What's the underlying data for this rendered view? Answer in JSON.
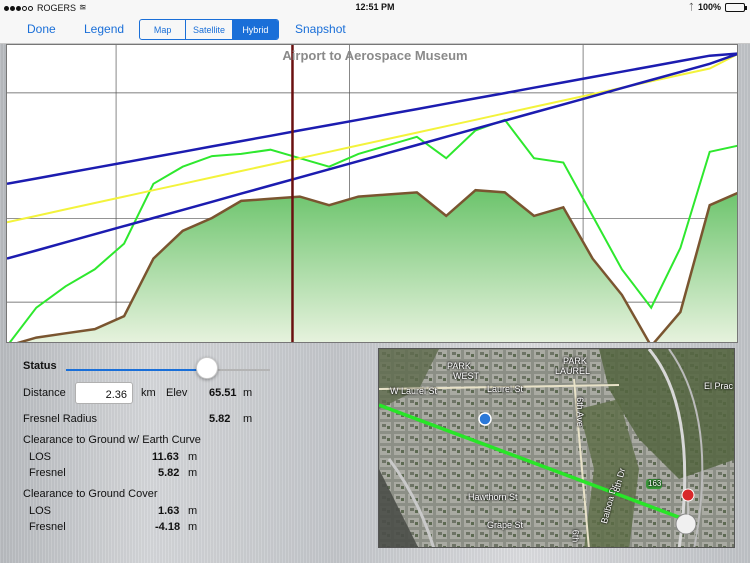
{
  "status_bar": {
    "carrier": "ROGERS",
    "time": "12:51 PM",
    "battery": "100%"
  },
  "toolbar": {
    "done_label": "Done",
    "legend_label": "Legend",
    "map_types": [
      "Map",
      "Satellite",
      "Hybrid"
    ],
    "selected_map_type": "Hybrid",
    "snapshot_label": "Snapshot"
  },
  "colors": {
    "accent": "#1a6fd8",
    "los_line": "#1c1cb0",
    "fresnel_center": "#f3f33c",
    "ground_cover": "#2ee82e",
    "terrain_fill": "#6cc46c",
    "terrain_edge": "#7a5530",
    "cursor": "#6a1010"
  },
  "chart_data": {
    "type": "line",
    "title": "Airport to Aerospace Museum",
    "grid": true,
    "x": [
      0,
      0.04,
      0.08,
      0.12,
      0.16,
      0.2,
      0.24,
      0.28,
      0.32,
      0.36,
      0.4,
      0.44,
      0.48,
      0.52,
      0.56,
      0.6,
      0.64,
      0.68,
      0.72,
      0.76,
      0.8,
      0.84,
      0.88,
      0.92,
      0.96,
      1.0
    ],
    "series": [
      {
        "key": "terrain",
        "values": [
          -6,
          -2,
          0,
          2,
          8,
          35,
          48,
          54,
          62,
          63,
          64,
          60,
          64,
          65,
          66,
          55,
          67,
          66,
          55,
          59,
          35,
          18,
          -6,
          10,
          60,
          66
        ]
      },
      {
        "key": "ground_cover",
        "values": [
          -6,
          12,
          22,
          30,
          42,
          70,
          78,
          83,
          84,
          86,
          82,
          78,
          84,
          88,
          92,
          82,
          95,
          100,
          82,
          80,
          55,
          30,
          12,
          40,
          85,
          88
        ]
      },
      {
        "key": "los_upper",
        "values": [
          70,
          72.5,
          75,
          77.5,
          80,
          82.5,
          85,
          87.5,
          90,
          92.5,
          95,
          97.5,
          100,
          102.5,
          105,
          107.5,
          110,
          112.5,
          115,
          117.5,
          120,
          122.5,
          125,
          127.5,
          130,
          131
        ]
      },
      {
        "key": "fresnel_center",
        "values": [
          52,
          55,
          58,
          61,
          64,
          67,
          70,
          73,
          76,
          79,
          82,
          85,
          88,
          91,
          94,
          97,
          100,
          103,
          106,
          109,
          112,
          115,
          118,
          121,
          124,
          131
        ]
      },
      {
        "key": "los_lower",
        "values": [
          35,
          38.8,
          42.6,
          46.4,
          50.2,
          54,
          57.8,
          61.6,
          65.4,
          69.2,
          73,
          76.8,
          80.6,
          84.4,
          88.2,
          92,
          95.8,
          99.6,
          103.4,
          107.2,
          111,
          114.8,
          118.6,
          122.4,
          126.2,
          131
        ]
      }
    ],
    "cursor_x": 0.39,
    "ylim": [
      -5,
      135
    ]
  },
  "panel": {
    "status_label": "Status",
    "slider_fraction": 0.69,
    "distance_label": "Distance",
    "distance_value": "2.36",
    "distance_unit": "km",
    "elev_label": "Elev",
    "elev_value": "65.51",
    "elev_unit": "m",
    "fresnel_radius_label": "Fresnel Radius",
    "fresnel_radius_value": "5.82",
    "fresnel_radius_unit": "m",
    "earth_curve_heading": "Clearance to Ground w/ Earth Curve",
    "earth_curve": {
      "los_label": "LOS",
      "los_value": "11.63",
      "los_unit": "m",
      "fresnel_label": "Fresnel",
      "fresnel_value": "5.82",
      "fresnel_unit": "m"
    },
    "ground_cover_heading": "Clearance to Ground Cover",
    "ground_cover": {
      "los_label": "LOS",
      "los_value": "1.63",
      "los_unit": "m",
      "fresnel_label": "Fresnel",
      "fresnel_value": "-4.18",
      "fresnel_unit": "m"
    }
  },
  "map": {
    "labels": {
      "park_west_1": "PARK",
      "park_west_2": "WEST",
      "park_laurel_1": "PARK",
      "park_laurel_2": "LAUREL",
      "w_laurel": "W Laurel St",
      "laurel": "Laurel St",
      "sixth_ave": "6th Ave",
      "el_prado": "El Prac",
      "hawthorn": "Hawthorn St",
      "grape": "Grape St",
      "balboa": "Balboa Dr",
      "eighth": "8th Dr",
      "route": "163",
      "sixth_b": "6th"
    }
  }
}
